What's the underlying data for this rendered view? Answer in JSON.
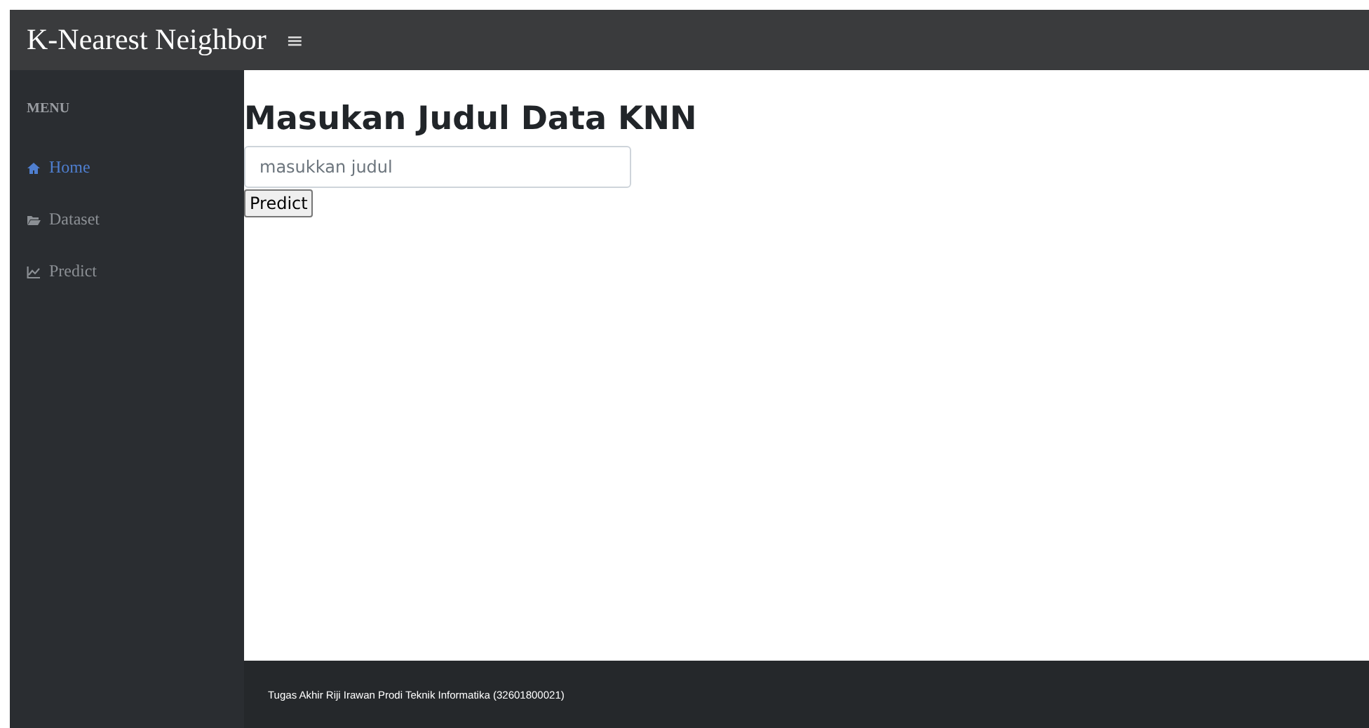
{
  "navbar": {
    "brand": "K-Nearest Neighbor",
    "menu_toggle": "≡"
  },
  "sidebar": {
    "heading": "MENU",
    "items": [
      {
        "label": "Home",
        "kind": "home",
        "selected": true
      },
      {
        "label": "Dataset",
        "kind": "folder",
        "selected": false
      },
      {
        "label": "Predict",
        "kind": "chart",
        "selected": false
      }
    ]
  },
  "main": {
    "title": "Masukan Judul Data KNN",
    "input": {
      "placeholder": "masukkan judul"
    },
    "button": "Predict"
  },
  "footer": {
    "text": "Tugas Akhir Riji Irawan Prodi Teknik Informatika (32601800021)"
  }
}
